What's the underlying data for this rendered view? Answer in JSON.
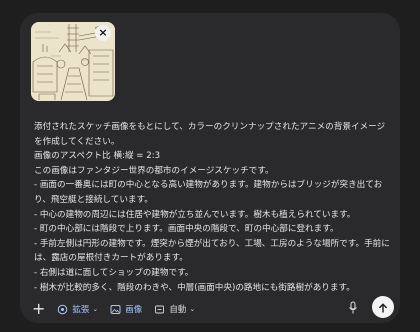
{
  "attachment": {
    "close_label": "×"
  },
  "prompt": {
    "text": "添付されたスケッチ画像をもとにして、カラーのクリンナップされたアニメの背景イメージを作成してください。\n画像のアスペクト比 横:縦 = 2:3\nこの画像はファンタジー世界の都市のイメージスケッチです。\n- 画面の一番奥には町の中心となる高い建物があります。建物からはブリッジが突き出ており、飛空艇と接続しています。\n- 中心の建物の周辺には住居や建物が立ち並んでいます。樹木も植えられています。\n- 町の中心部には階段で上ります。画面中央の階段で、町の中心部に登れます。\n- 手前左側は円形の建物です。煙突から煙が出ており、工場、工房のような場所です。手前には、露店の屋根付きカートがあります。\n- 右側は道に面してショップの建物です。\n- 樹木が比較的多く、階段のわきや、中層(画面中央)の路地にも街路樹があります。"
  },
  "toolbar": {
    "plus_label": "+",
    "expand_label": "拡張",
    "image_label": "画像",
    "auto_label": "自動",
    "chevron": "⌄"
  },
  "colors": {
    "background": "#1e1e1f",
    "panel": "#2a2a2c",
    "accent": "#a8c7fa",
    "send_button": "#f4f4f4"
  },
  "icons": [
    "close-icon",
    "plus-icon",
    "expand-icon",
    "image-icon",
    "auto-icon",
    "mic-icon",
    "send-arrow-icon"
  ]
}
